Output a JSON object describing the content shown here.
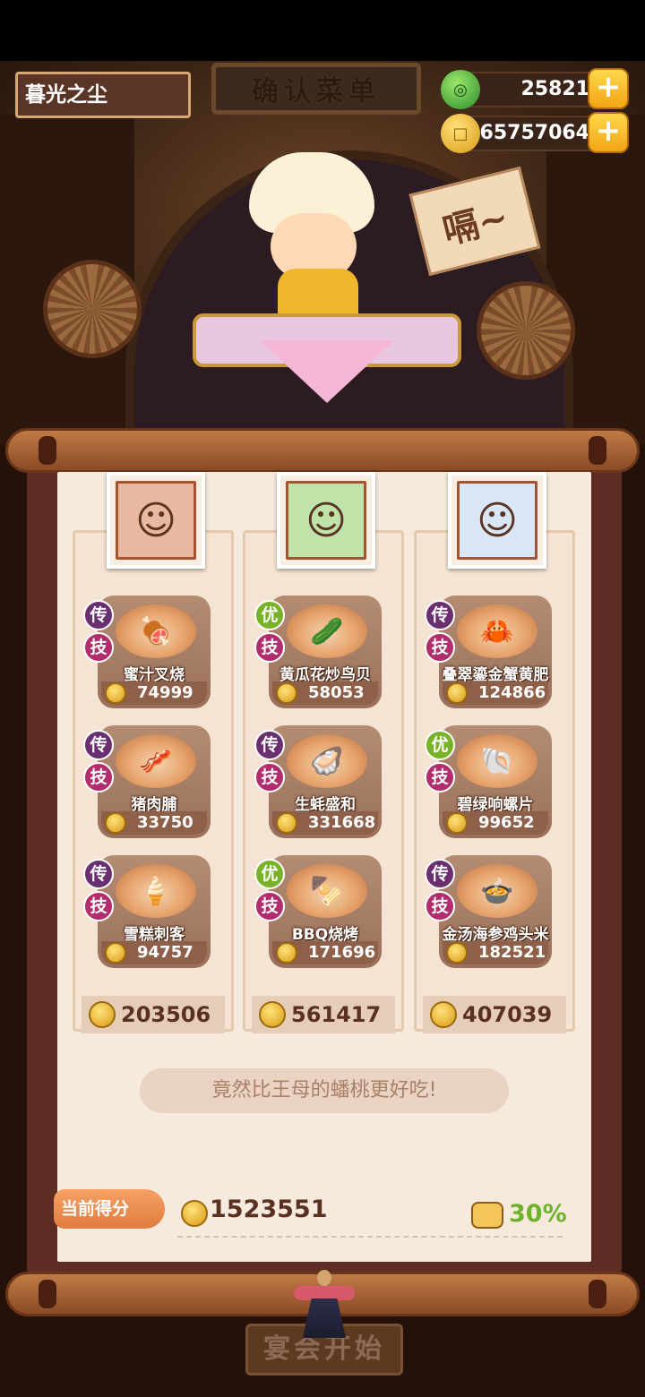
{
  "header": {
    "player_name": "暮光之尘",
    "sign_title": "确认菜单",
    "jade_amount": "25821",
    "coin_amount": "65757064",
    "plus_symbol": "+"
  },
  "scene": {
    "speech_text": "嗝~"
  },
  "columns": [
    {
      "total": "203506",
      "dishes": [
        {
          "name": "蜜汁叉烧",
          "price": "74999",
          "grade": "传",
          "skill": "技"
        },
        {
          "name": "猪肉脯",
          "price": "33750",
          "grade": "传",
          "skill": "技"
        },
        {
          "name": "雪糕刺客",
          "price": "94757",
          "grade": "传",
          "skill": "技"
        }
      ]
    },
    {
      "total": "561417",
      "dishes": [
        {
          "name": "黄瓜花炒鸟贝",
          "price": "58053",
          "grade": "优",
          "skill": "技"
        },
        {
          "name": "生蚝盛和",
          "price": "331668",
          "grade": "传",
          "skill": "技"
        },
        {
          "name": "BBQ烧烤",
          "price": "171696",
          "grade": "优",
          "skill": "技"
        }
      ]
    },
    {
      "total": "407039",
      "dishes": [
        {
          "name": "叠翠鎏金蟹黄肥",
          "price": "124866",
          "grade": "传",
          "skill": "技"
        },
        {
          "name": "碧绿响螺片",
          "price": "99652",
          "grade": "优",
          "skill": "技"
        },
        {
          "name": "金汤海参鸡头米",
          "price": "182521",
          "grade": "传",
          "skill": "技"
        }
      ]
    }
  ],
  "comment": "竟然比王母的蟠桃更好吃!",
  "score": {
    "label": "当前得分",
    "value": "1523551",
    "bonus": "30%"
  },
  "start_button": "宴会开始",
  "colors": {
    "legend_badge": "#6a2f6e",
    "good_badge": "#78b228",
    "skill_badge": "#b22d6b",
    "bonus_text": "#6fb32c"
  },
  "icons": {
    "jade": "jade-coin-icon",
    "coin": "gold-coin-icon",
    "plus": "plus-icon",
    "bonus": "bonus-treasure-icon"
  }
}
